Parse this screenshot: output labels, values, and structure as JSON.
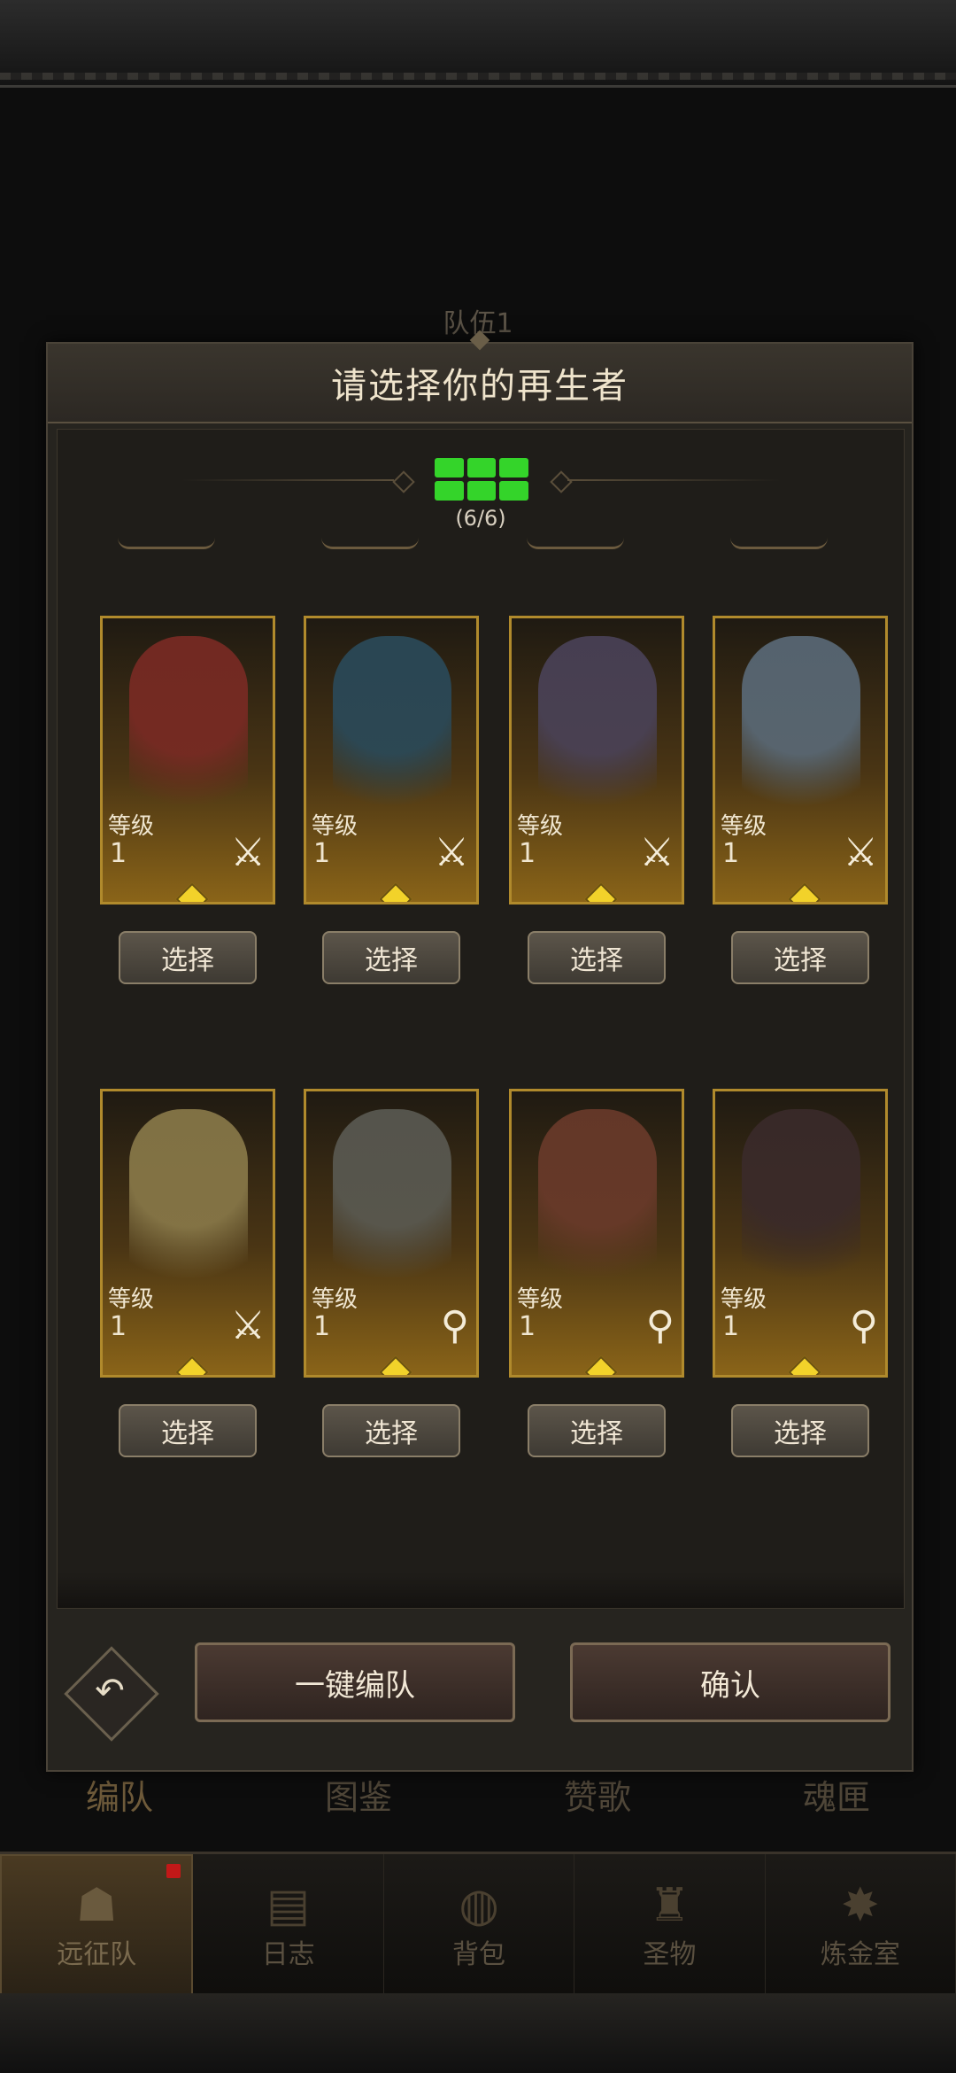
{
  "background": {
    "team_title": "队伍1",
    "tabs": [
      "编队",
      "图鉴",
      "赞歌",
      "魂匣"
    ]
  },
  "bottom_nav": [
    {
      "label": "远征队",
      "icon": "helmet-icon"
    },
    {
      "label": "日志",
      "icon": "scroll-icon"
    },
    {
      "label": "背包",
      "icon": "bag-icon"
    },
    {
      "label": "圣物",
      "icon": "relic-icon"
    },
    {
      "label": "炼金室",
      "icon": "alchemy-icon"
    }
  ],
  "modal": {
    "title": "请选择你的再生者",
    "count": "(6/6)",
    "level_label": "等级",
    "select_label": "选择",
    "heroes": [
      {
        "level": "1",
        "weapon": "sword-icon",
        "accent": "#7a2a24"
      },
      {
        "level": "1",
        "weapon": "sword-icon",
        "accent": "#2a4a5a"
      },
      {
        "level": "1",
        "weapon": "sword-icon",
        "accent": "#4a4258"
      },
      {
        "level": "1",
        "weapon": "sword-icon",
        "accent": "#5a6a78"
      },
      {
        "level": "1",
        "weapon": "sword-icon",
        "accent": "#8a7a4a"
      },
      {
        "level": "1",
        "weapon": "staff-icon",
        "accent": "#5a5a52"
      },
      {
        "level": "1",
        "weapon": "staff-icon",
        "accent": "#6a3a2a"
      },
      {
        "level": "1",
        "weapon": "staff-icon",
        "accent": "#3a2a2a"
      }
    ],
    "auto_form_label": "一键编队",
    "confirm_label": "确认"
  }
}
